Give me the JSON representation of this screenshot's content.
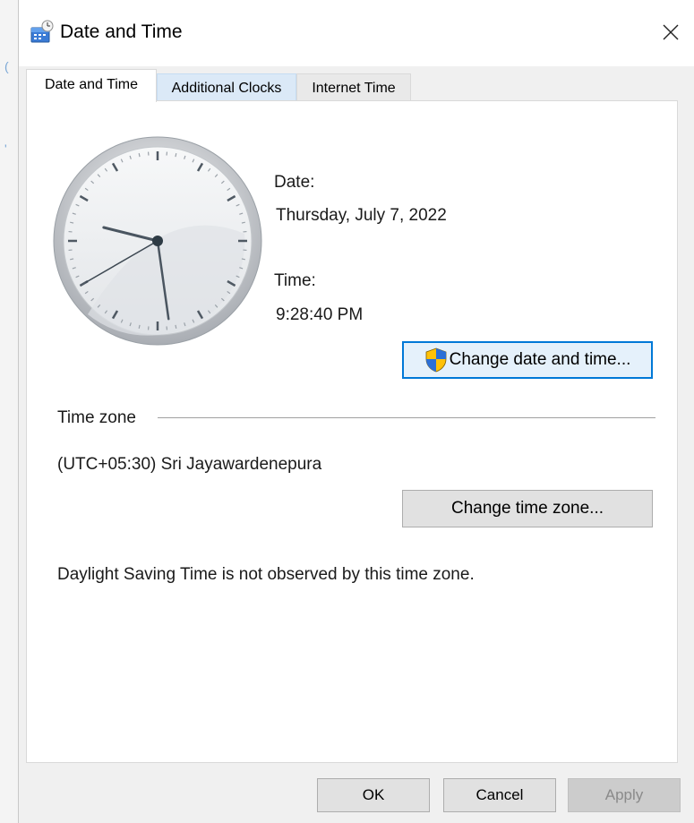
{
  "window": {
    "title": "Date and Time"
  },
  "tabs": [
    {
      "label": "Date and Time"
    },
    {
      "label": "Additional Clocks"
    },
    {
      "label": "Internet Time"
    }
  ],
  "clock": {
    "hours": 9,
    "minutes": 28,
    "seconds": 40
  },
  "date": {
    "label": "Date:",
    "value": "Thursday, July 7, 2022"
  },
  "time": {
    "label": "Time:",
    "value": "9:28:40 PM"
  },
  "buttons": {
    "change_date_time": "Change date and time...",
    "change_time_zone": "Change time zone...",
    "ok": "OK",
    "cancel": "Cancel",
    "apply": "Apply"
  },
  "timezone": {
    "section_label": "Time zone",
    "value": "(UTC+05:30) Sri Jayawardenepura",
    "dst_note": "Daylight Saving Time is not observed by this time zone."
  }
}
